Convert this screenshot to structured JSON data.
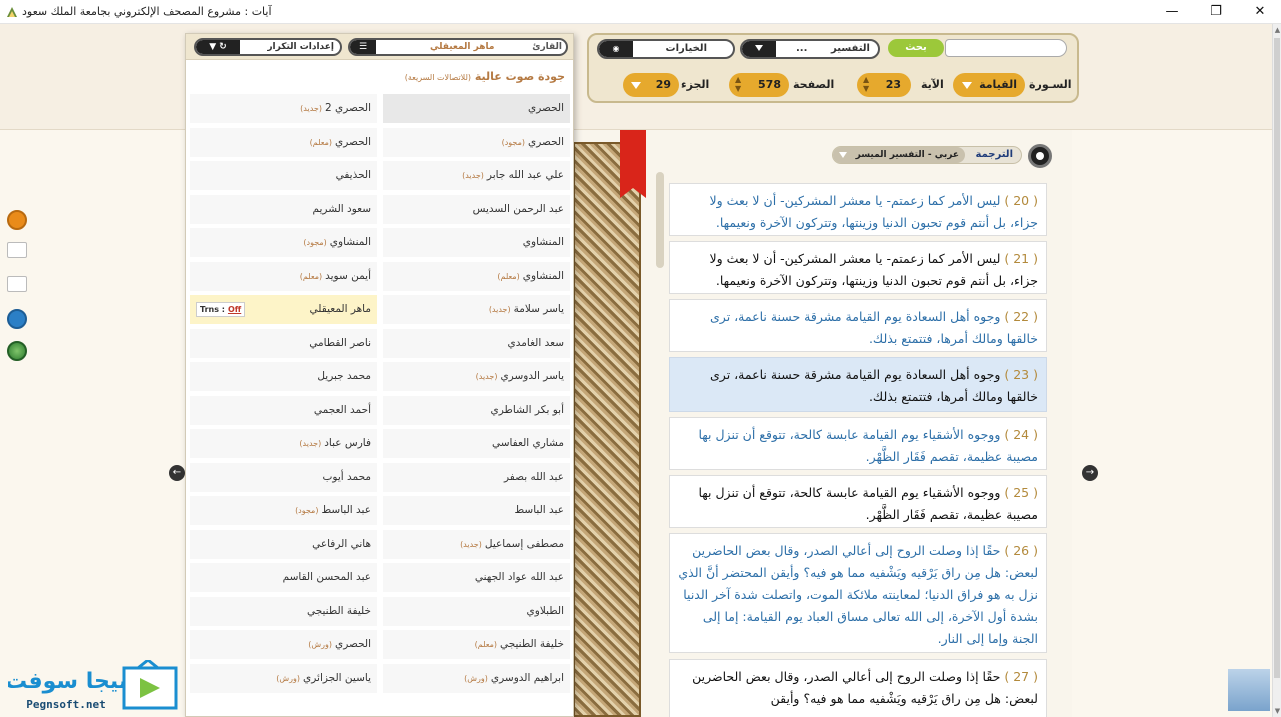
{
  "window": {
    "title": "آيات : مشروع المصحف الإلكتروني بجامعة الملك سعود",
    "min": "—",
    "max": "❐",
    "close": "✕"
  },
  "toolbar": {
    "search_btn": "بحث",
    "tafsir_label": "التفسير",
    "tafsir_value": "...",
    "options_label": "الخيارات",
    "surah_label": "السـورة",
    "surah_value": "القيامة",
    "ayah_label": "الآية",
    "ayah_value": "23",
    "page_label": "الصفحة",
    "page_value": "578",
    "juz_label": "الجزء",
    "juz_value": "29"
  },
  "reader_panel": {
    "reader_label": "القارئ",
    "reader_value": "ماهر المعيقلي",
    "repeat_label": "إعدادات التكرار",
    "quality_title": "جودة صوت عالية",
    "quality_note": "(للاتصالات السريعة)",
    "trns_label": "Trns :",
    "trns_value": "Off",
    "rows": [
      {
        "right": "الحصري",
        "rtag": "",
        "rbold": false,
        "left": "الحصري 2",
        "ltag": "(جديد)",
        "lbold": false
      },
      {
        "right": "الحصري",
        "rtag": "(مجود)",
        "rbold": false,
        "left": "الحصري",
        "ltag": "(معلم)",
        "lbold": true
      },
      {
        "right": "علي عبد الله جابر",
        "rtag": "(جديد)",
        "rbold": true,
        "left": "الحذيفي",
        "ltag": "",
        "lbold": false
      },
      {
        "right": "عبد الرحمن السديس",
        "rtag": "",
        "rbold": false,
        "left": "سعود الشريم",
        "ltag": "",
        "lbold": false
      },
      {
        "right": "المنشاوي",
        "rtag": "",
        "rbold": false,
        "left": "المنشاوي",
        "ltag": "(مجود)",
        "lbold": false
      },
      {
        "right": "المنشاوي",
        "rtag": "(معلم)",
        "rbold": true,
        "left": "أيمن سويد",
        "ltag": "(معلم)",
        "lbold": true
      },
      {
        "right": "ياسر سلامة",
        "rtag": "(جديد)",
        "rbold": false,
        "left": "ماهر المعيقلي",
        "ltag": "",
        "lbold": false
      },
      {
        "right": "سعد الغامدي",
        "rtag": "",
        "rbold": false,
        "left": "ناصر القطامي",
        "ltag": "",
        "lbold": false
      },
      {
        "right": "ياسر الدوسري",
        "rtag": "(جديد)",
        "rbold": false,
        "left": "محمد جبريل",
        "ltag": "",
        "lbold": false
      },
      {
        "right": "أبو بكر الشاطري",
        "rtag": "",
        "rbold": false,
        "left": "أحمد العجمي",
        "ltag": "",
        "lbold": false
      },
      {
        "right": "مشاري العفاسي",
        "rtag": "",
        "rbold": false,
        "left": "فارس عباد",
        "ltag": "(جديد)",
        "lbold": false
      },
      {
        "right": "عبد الله بصفر",
        "rtag": "",
        "rbold": false,
        "left": "محمد أيوب",
        "ltag": "",
        "lbold": false
      },
      {
        "right": "عبد الباسط",
        "rtag": "",
        "rbold": false,
        "left": "عبد الباسط",
        "ltag": "(مجود)",
        "lbold": false
      },
      {
        "right": "مصطفى إسماعيل",
        "rtag": "(جديد)",
        "rbold": false,
        "left": "هاني الرفاعي",
        "ltag": "",
        "lbold": false
      },
      {
        "right": "عبد الله عواد الجهني",
        "rtag": "",
        "rbold": false,
        "left": "عبد المحسن القاسم",
        "ltag": "",
        "lbold": false
      },
      {
        "right": "الطبلاوي",
        "rtag": "",
        "rbold": false,
        "left": "خليفة الطنيجي",
        "ltag": "",
        "lbold": false
      },
      {
        "right": "خليفة الطنيجي",
        "rtag": "(معلم)",
        "rbold": true,
        "left": "الحصري",
        "ltag": "(ورش)",
        "lbold": true
      },
      {
        "right": "ابراهيم الدوسري",
        "rtag": "(ورش)",
        "rbold": true,
        "left": "ياسين الجزائري",
        "ltag": "(ورش)",
        "lbold": true
      }
    ]
  },
  "tafsir_panel": {
    "translation_label": "الترجمة",
    "translation_value": "عربي - التفسير الميسر"
  },
  "verses": [
    {
      "num": "( 20 )",
      "text": "ليس الأمر كما زعمتم- يا معشر المشركين- أن لا بعث ولا جزاء، بل أنتم قوم تحبون الدنيا وزينتها، وتتركون الآخرة ونعيمها.",
      "style": "blue"
    },
    {
      "num": "( 21 )",
      "text": "ليس الأمر كما زعمتم- يا معشر المشركين- أن لا بعث ولا جزاء، بل أنتم قوم تحبون الدنيا وزينتها، وتتركون الآخرة ونعيمها.",
      "style": "dark"
    },
    {
      "num": "( 22 )",
      "text": "وجوه أهل السعادة يوم القيامة مشرقة حسنة ناعمة، ترى خالقها ومالك أمرها، فتتمتع بذلك.",
      "style": "blue"
    },
    {
      "num": "( 23 )",
      "text": "وجوه أهل السعادة يوم القيامة مشرقة حسنة ناعمة، ترى خالقها ومالك أمرها، فتتمتع بذلك.",
      "style": "sel"
    },
    {
      "num": "( 24 )",
      "text": "ووجوه الأشقياء يوم القيامة عابسة كالحة، تتوقع أن تنزل بها مصيبة عظيمة، تقصم فَقَار الظَّهْر.",
      "style": "blue"
    },
    {
      "num": "( 25 )",
      "text": "ووجوه الأشقياء يوم القيامة عابسة كالحة، تتوقع أن تنزل بها مصيبة عظيمة، تقصم فَقَار الظَّهْر.",
      "style": "dark"
    },
    {
      "num": "( 26 )",
      "text": "حقًا إذا وصلت الروح إلى أعالي الصدر، وقال بعض الحاضرين لبعض: هل مِن راق يَرْقيه ويَشْفيه مما هو فيه؟ وأيقن المحتضر أنَّ الذي نزل به هو فراق الدنيا؛ لمعاينته ملائكة الموت، واتصلت شدة آخر الدنيا بشدة أول الآخرة، إلى الله تعالى مساق العباد يوم القيامة: إما إلى الجنة وإما إلى النار.",
      "style": "blue"
    },
    {
      "num": "( 27 )",
      "text": "حقًا إذا وصلت الروح إلى أعالي الصدر، وقال بعض الحاضرين لبعض: هل مِن راق يَرْقيه ويَشْفيه مما هو فيه؟ وأيقن",
      "style": "dark"
    }
  ],
  "watermark": {
    "brand": "بيجا سوفت",
    "url": "Pegnsoft.net"
  },
  "colors": {
    "gold": "#e6a92d",
    "green": "#9cc83a",
    "verse_blue": "#2d6fa8",
    "selected_bg": "#dbe8f6",
    "ribbon": "#d9251a"
  }
}
